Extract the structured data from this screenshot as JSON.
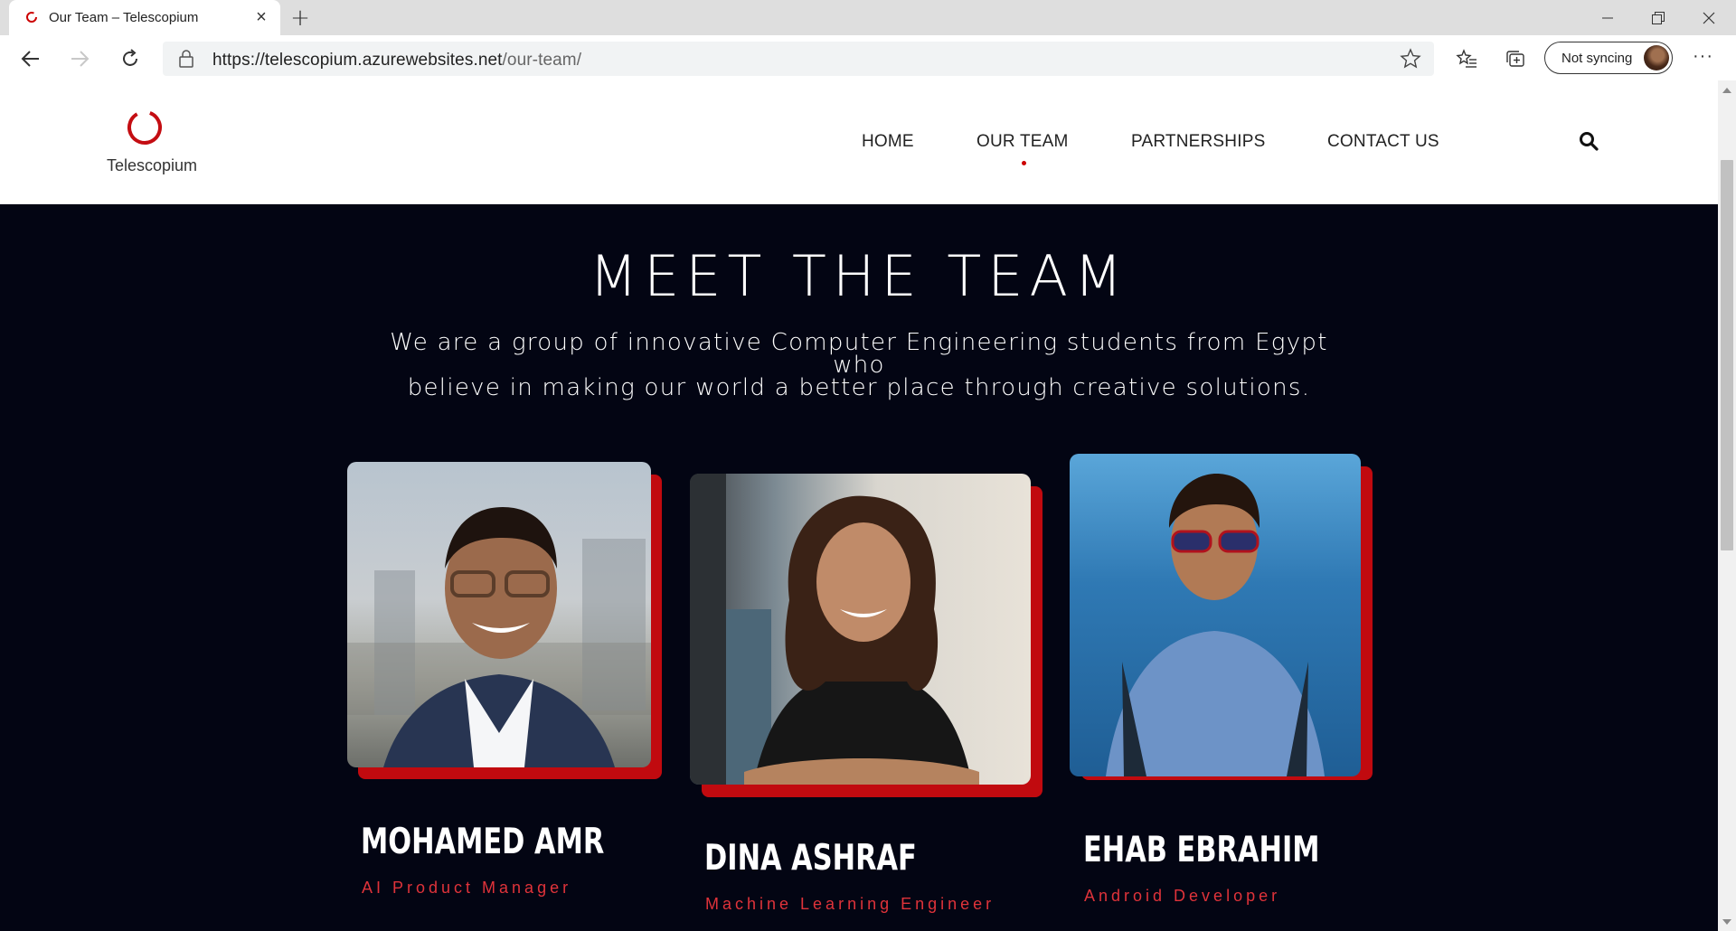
{
  "browser": {
    "tab_title": "Our Team – Telescopium",
    "url_host": "https://telescopium.azurewebsites.net",
    "url_path": "/our-team/",
    "sync_label": "Not syncing"
  },
  "site": {
    "logo_text": "Telescopium",
    "nav": {
      "home": "HOME",
      "team": "OUR TEAM",
      "partnerships": "PARTNERSHIPS",
      "contact": "CONTACT US"
    },
    "active_nav": "OUR TEAM"
  },
  "hero": {
    "title": "MEET THE TEAM",
    "subtitle_line1": "We are a group of innovative Computer Engineering students from Egypt who",
    "subtitle_line2": "believe in making our world a better place through creative solutions."
  },
  "team": [
    {
      "name": "MOHAMED AMR",
      "role": "AI Product Manager"
    },
    {
      "name": "DINA ASHRAF",
      "role": "Machine Learning Engineer"
    },
    {
      "name": "EHAB EBRAHIM",
      "role": "Android Developer"
    }
  ],
  "colors": {
    "accent_red": "#c10a0f",
    "role_red": "#e0333a",
    "hero_bg": "#030513"
  }
}
